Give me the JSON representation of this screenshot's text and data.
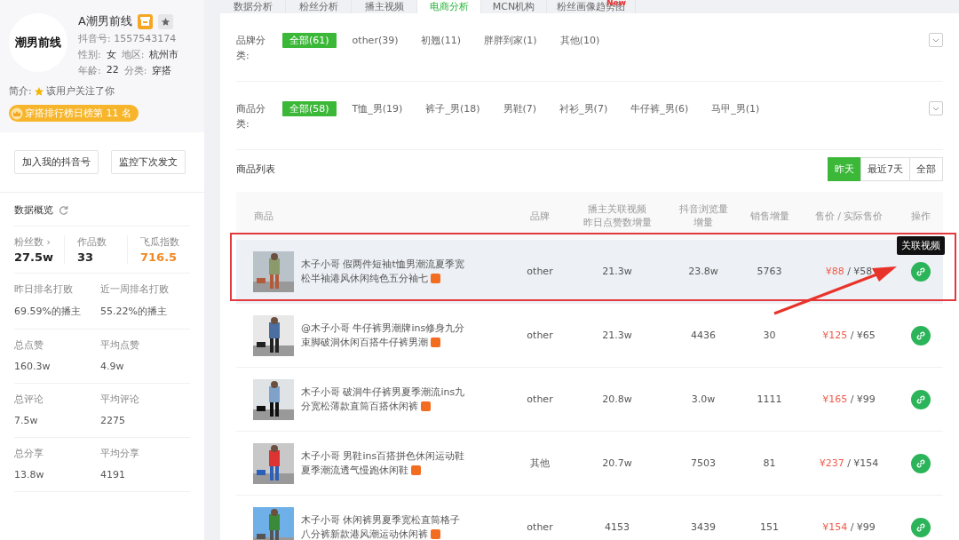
{
  "profile": {
    "logo_text": "潮男前线",
    "name": "A潮男前线",
    "douyin_id": "抖音号: 1557543174",
    "gender_label": "性别:",
    "gender": "女",
    "region_label": "地区:",
    "region": "杭州市",
    "age_label": "年龄:",
    "age": "22",
    "category_label": "分类:",
    "category": "穿搭",
    "intro_label": "简介:",
    "intro": "该用户关注了你",
    "rank_badge": "穿搭排行榜日榜第 11 名"
  },
  "actions": [
    "加入我的抖音号",
    "监控下次发文"
  ],
  "overview": {
    "title": "数据概览",
    "top_stats": [
      {
        "label": "粉丝数 ›",
        "value": "27.5w",
        "highlight": false
      },
      {
        "label": "作品数",
        "value": "33",
        "highlight": false
      },
      {
        "label": "飞瓜指数",
        "value": "716.5",
        "highlight": true
      }
    ],
    "pairs": [
      [
        {
          "label": "昨日排名打败",
          "value": "69.59%的播主"
        },
        {
          "label": "近一周排名打败",
          "value": "55.22%的播主"
        }
      ],
      [
        {
          "label": "总点赞",
          "value": "160.3w"
        },
        {
          "label": "平均点赞",
          "value": "4.9w"
        }
      ],
      [
        {
          "label": "总评论",
          "value": "7.5w"
        },
        {
          "label": "平均评论",
          "value": "2275"
        }
      ],
      [
        {
          "label": "总分享",
          "value": "13.8w"
        },
        {
          "label": "平均分享",
          "value": "4191"
        }
      ]
    ]
  },
  "tabs": [
    {
      "label": "数据分析",
      "selected": false
    },
    {
      "label": "粉丝分析",
      "selected": false
    },
    {
      "label": "播主视频",
      "selected": false
    },
    {
      "label": "电商分析",
      "selected": true
    },
    {
      "label": "MCN机构",
      "selected": false
    },
    {
      "label": "粉丝画像趋势图",
      "selected": false,
      "badge": "New"
    }
  ],
  "filters": [
    {
      "label": "品牌分类:",
      "options": [
        {
          "label": "全部(61)",
          "selected": true
        },
        {
          "label": "other(39)",
          "selected": false
        },
        {
          "label": "初翘(11)",
          "selected": false
        },
        {
          "label": "胖胖到家(1)",
          "selected": false
        },
        {
          "label": "其他(10)",
          "selected": false
        }
      ]
    },
    {
      "label": "商品分类:",
      "options": [
        {
          "label": "全部(58)",
          "selected": true
        },
        {
          "label": "T恤_男(19)",
          "selected": false
        },
        {
          "label": "裤子_男(18)",
          "selected": false
        },
        {
          "label": "男鞋(7)",
          "selected": false
        },
        {
          "label": "衬衫_男(7)",
          "selected": false
        },
        {
          "label": "牛仔裤_男(6)",
          "selected": false
        },
        {
          "label": "马甲_男(1)",
          "selected": false
        }
      ]
    }
  ],
  "list_title": "商品列表",
  "periods": [
    {
      "label": "昨天",
      "selected": true
    },
    {
      "label": "最近7天",
      "selected": false
    },
    {
      "label": "全部",
      "selected": false
    }
  ],
  "table": {
    "columns": [
      [
        "商品"
      ],
      [
        "品牌"
      ],
      [
        "播主关联视频",
        "昨日点赞数增量"
      ],
      [
        "抖音浏览量",
        "增量"
      ],
      [
        "销售增量"
      ],
      [
        "售价 / 实际售价"
      ],
      [
        "操作"
      ]
    ],
    "rows": [
      {
        "title": "木子小哥 假两件短袖t恤男潮流夏季宽松半袖港风休闲纯色五分袖七",
        "brand": "other",
        "likes": "21.3w",
        "views": "23.8w",
        "sales": "5763",
        "price": "¥88",
        "separator": "/",
        "real_price": "¥58",
        "selected": true,
        "tooltip": "关联视频"
      },
      {
        "title": "@木子小哥 牛仔裤男潮牌ins修身九分束脚破洞休闲百搭牛仔裤男潮",
        "brand": "other",
        "likes": "21.3w",
        "views": "4436",
        "sales": "30",
        "price": "¥125",
        "separator": "/",
        "real_price": "¥65",
        "selected": false
      },
      {
        "title": "木子小哥 破洞牛仔裤男夏季潮流ins九分宽松薄款直筒百搭休闲裤",
        "brand": "other",
        "likes": "20.8w",
        "views": "3.0w",
        "sales": "1111",
        "price": "¥165",
        "separator": "/",
        "real_price": "¥99",
        "selected": false
      },
      {
        "title": "木子小哥 男鞋ins百搭拼色休闲运动鞋夏季潮流透气慢跑休闲鞋",
        "brand": "其他",
        "likes": "20.7w",
        "views": "7503",
        "sales": "81",
        "price": "¥237",
        "separator": "/",
        "real_price": "¥154",
        "selected": false
      },
      {
        "title": "木子小哥 休闲裤男夏季宽松直筒格子八分裤新款港风潮运动休闲裤",
        "brand": "other",
        "likes": "4153",
        "views": "3439",
        "sales": "151",
        "price": "¥154",
        "separator": "/",
        "real_price": "¥99",
        "selected": false
      }
    ]
  }
}
